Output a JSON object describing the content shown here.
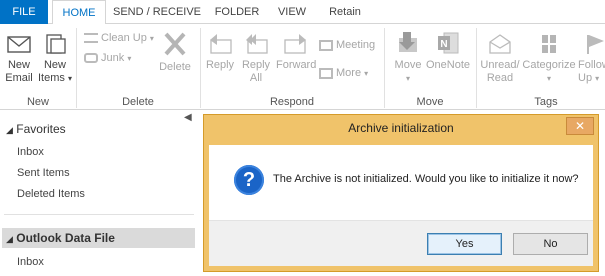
{
  "tabs": {
    "file": "FILE",
    "home": "HOME",
    "send_receive": "SEND / RECEIVE",
    "folder": "FOLDER",
    "view": "VIEW",
    "retain": "Retain"
  },
  "ribbon": {
    "new_email": [
      "New",
      "Email"
    ],
    "new_items": [
      "New",
      "Items"
    ],
    "clean_up": "Clean Up",
    "junk": "Junk",
    "delete": "Delete",
    "reply": "Reply",
    "reply_all": [
      "Reply",
      "All"
    ],
    "forward": "Forward",
    "meeting": "Meeting",
    "more": "More",
    "move": "Move",
    "onenote": "OneNote",
    "unread_read": [
      "Unread/",
      "Read"
    ],
    "categorize": "Categorize",
    "follow_up": [
      "Follow",
      "Up"
    ],
    "groups": {
      "new": "New",
      "delete": "Delete",
      "respond": "Respond",
      "move": "Move",
      "tags": "Tags"
    }
  },
  "folder_pane": {
    "favorites_header": "Favorites",
    "favorites": [
      "Inbox",
      "Sent Items",
      "Deleted Items"
    ],
    "data_file_header": "Outlook Data File",
    "data_file_items": [
      "Inbox"
    ]
  },
  "dialog": {
    "title": "Archive initialization",
    "message": "The Archive is not initialized. Would you like to initialize it now?",
    "yes_label": "Yes",
    "no_label": "No",
    "close_glyph": "✕",
    "icon_glyph": "?"
  },
  "colors": {
    "accent": "#0072c6",
    "dialog_frame": "#f0c36a",
    "question_icon": "#1a64c7"
  }
}
